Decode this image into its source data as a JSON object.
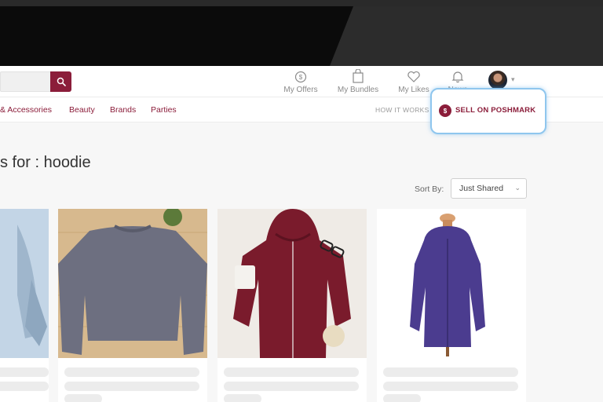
{
  "header": {
    "nav": [
      {
        "label": "My Offers",
        "icon": "offers-icon"
      },
      {
        "label": "My Bundles",
        "icon": "bundle-bag-icon"
      },
      {
        "label": "My Likes",
        "icon": "heart-icon"
      },
      {
        "label": "News",
        "icon": "bell-icon"
      }
    ],
    "search_icon": "search-icon"
  },
  "subnav": {
    "categories": [
      "& Accessories",
      "Beauty",
      "Brands",
      "Parties"
    ],
    "how_it_works": "HOW IT WORKS",
    "sell": "SELL ON POSHMARK",
    "sell_icon_glyph": "$"
  },
  "results": {
    "title": "s for : hoodie",
    "sort_label": "Sort By:",
    "sort_value": "Just Shared"
  },
  "listings": [
    {
      "item": "light blue hoodie (cropped)"
    },
    {
      "item": "gray cropped pullover"
    },
    {
      "item": "maroon zip hoodie"
    },
    {
      "item": "purple zip hoodie"
    }
  ],
  "colors": {
    "brand": "#8b1d3a",
    "highlight": "#8fc6ee"
  }
}
